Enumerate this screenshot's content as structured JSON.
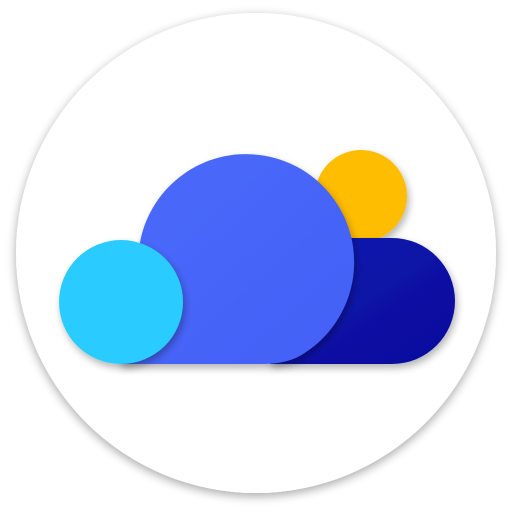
{
  "icon": {
    "name": "cloud-weather-app-icon",
    "colors": {
      "background_circle": "#ffffff",
      "sun": "#FFBD00",
      "dark_cloud": "#0A14A8",
      "main_cloud": "#4766FA",
      "small_cloud": "#29CCFF"
    }
  }
}
